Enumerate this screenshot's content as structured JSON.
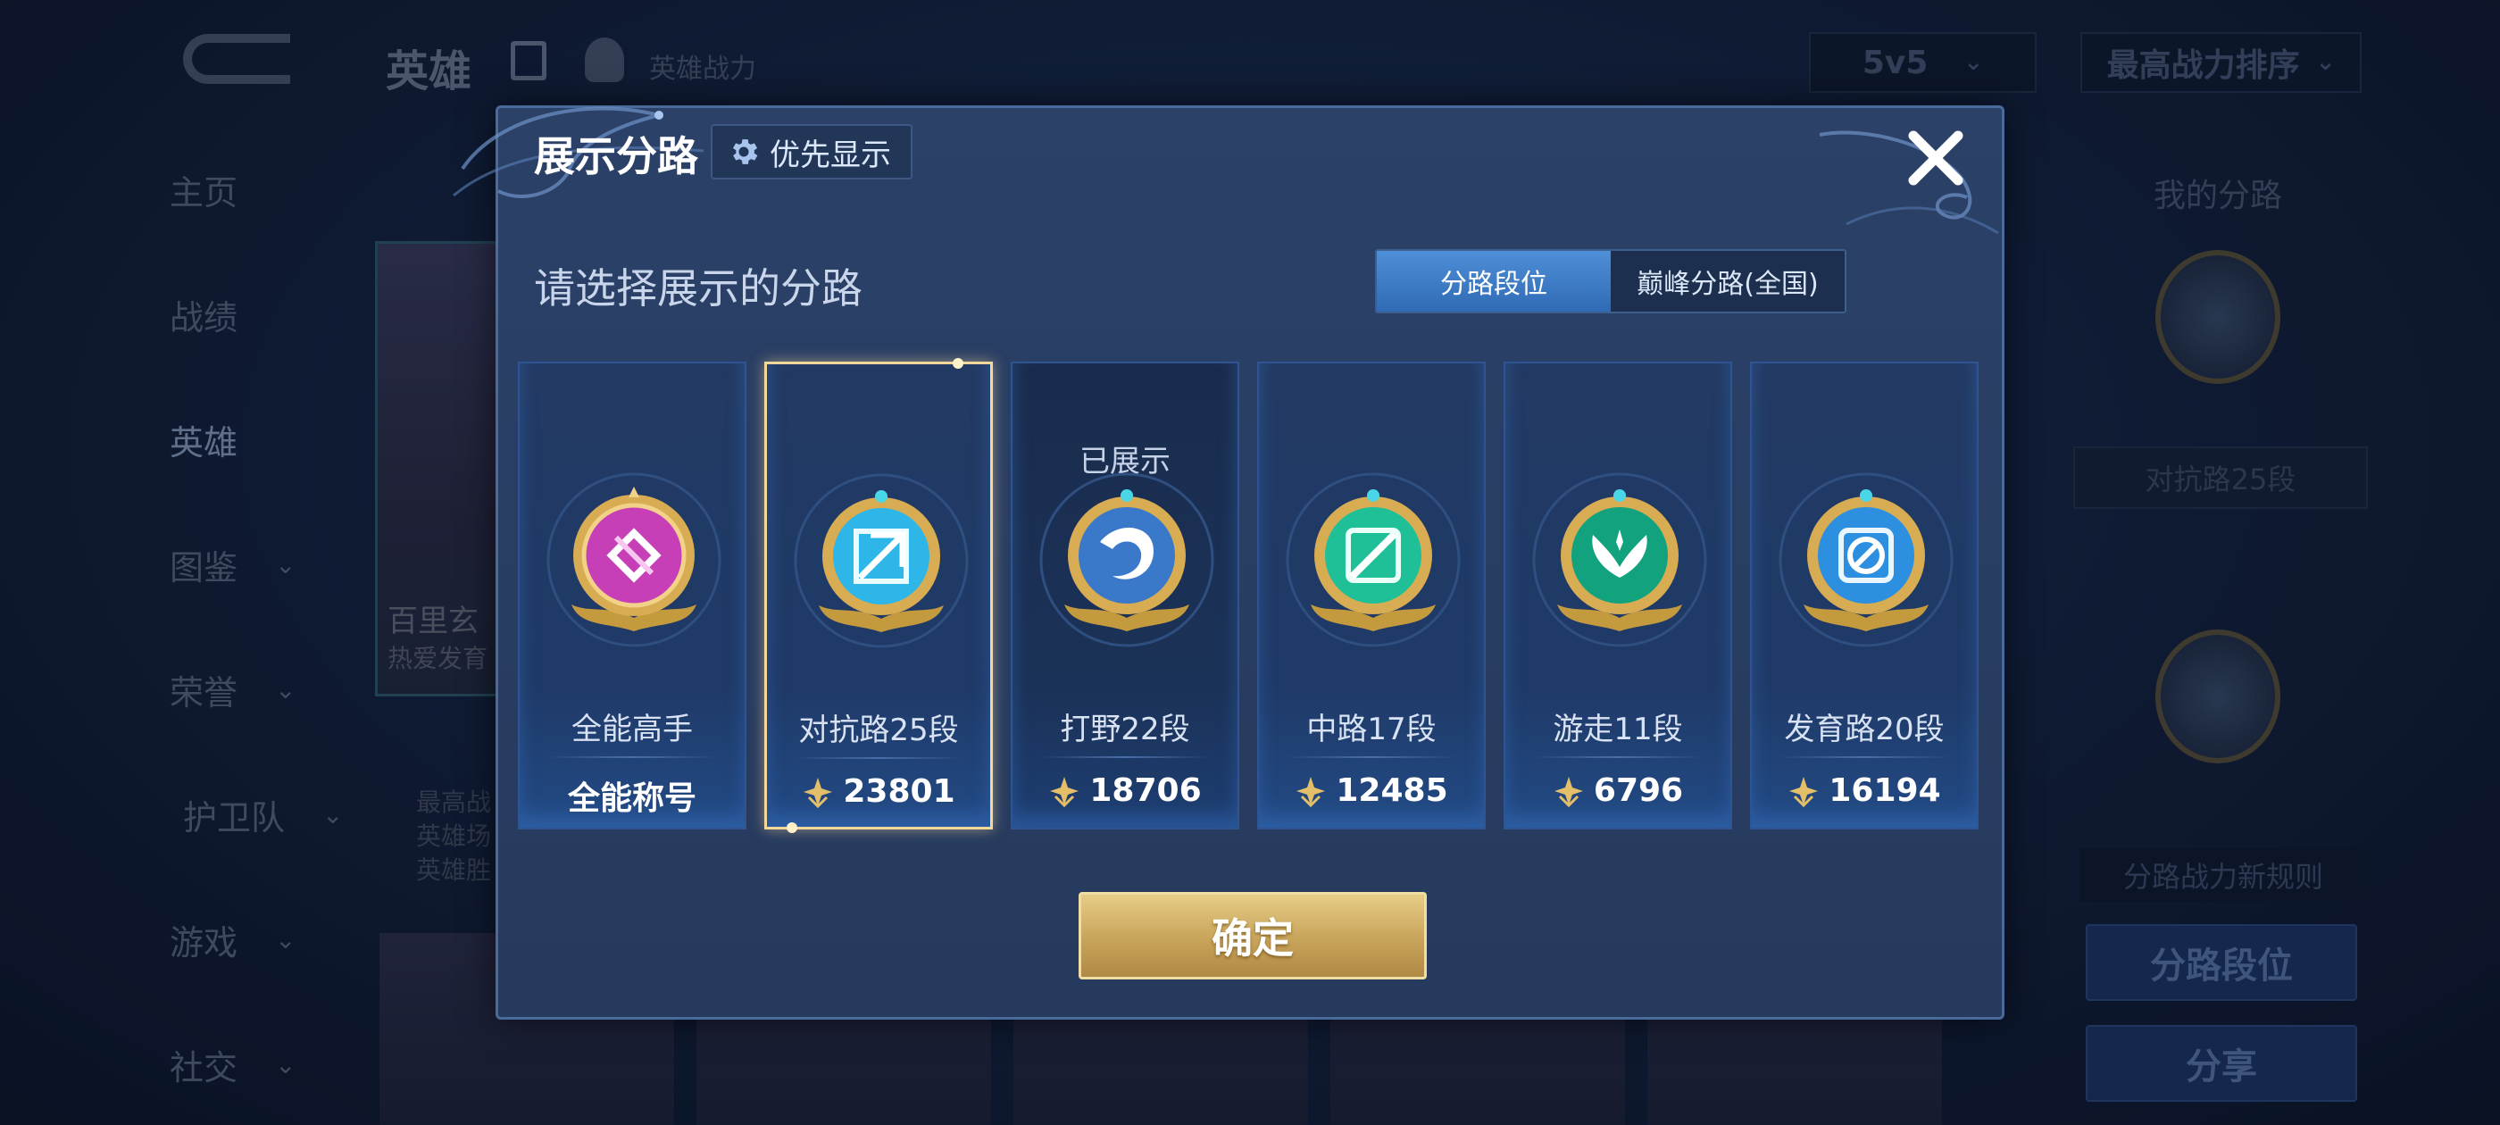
{
  "background": {
    "title": "英雄",
    "power_label": "英雄战力",
    "mode_select": "5v5",
    "sort_select": "最高战力排序",
    "nav": [
      {
        "label": "主页"
      },
      {
        "label": "战绩"
      },
      {
        "label": "英雄"
      },
      {
        "label": "图鉴"
      },
      {
        "label": "荣誉"
      },
      {
        "label": "护卫队"
      },
      {
        "label": "游戏"
      },
      {
        "label": "社交"
      }
    ],
    "hero_name": "百里玄",
    "hero_sub": "热爱发育",
    "hero_stats": [
      "最高战",
      "英雄场",
      "英雄胜"
    ],
    "right_title": "我的分路",
    "right_rank": "对抗路25段",
    "right_rule": "分路战力新规则",
    "right_btn_rank": "分路段位",
    "right_btn_share": "分享"
  },
  "modal": {
    "title": "展示分路",
    "priority_label": "优先显示",
    "subtitle": "请选择展示的分路",
    "tabs": [
      {
        "label": "分路段位",
        "active": true
      },
      {
        "label": "巅峰分路(全国)",
        "active": false
      }
    ],
    "shown_label": "已展示",
    "cards": [
      {
        "name": "全能高手",
        "value": "全能称号",
        "icon": "all-round-badge-icon",
        "color": "#c63fb7"
      },
      {
        "name": "对抗路25段",
        "value": "23801",
        "icon": "clash-lane-badge-icon",
        "color": "#2fb6e8"
      },
      {
        "name": "打野22段",
        "value": "18706",
        "icon": "jungle-badge-icon",
        "color": "#3a78c9"
      },
      {
        "name": "中路17段",
        "value": "12485",
        "icon": "mid-lane-badge-icon",
        "color": "#1fbf98"
      },
      {
        "name": "游走11段",
        "value": "6796",
        "icon": "roam-badge-icon",
        "color": "#12a27e"
      },
      {
        "name": "发育路20段",
        "value": "16194",
        "icon": "farm-lane-badge-icon",
        "color": "#2c8fe0"
      }
    ],
    "confirm_label": "确定"
  }
}
